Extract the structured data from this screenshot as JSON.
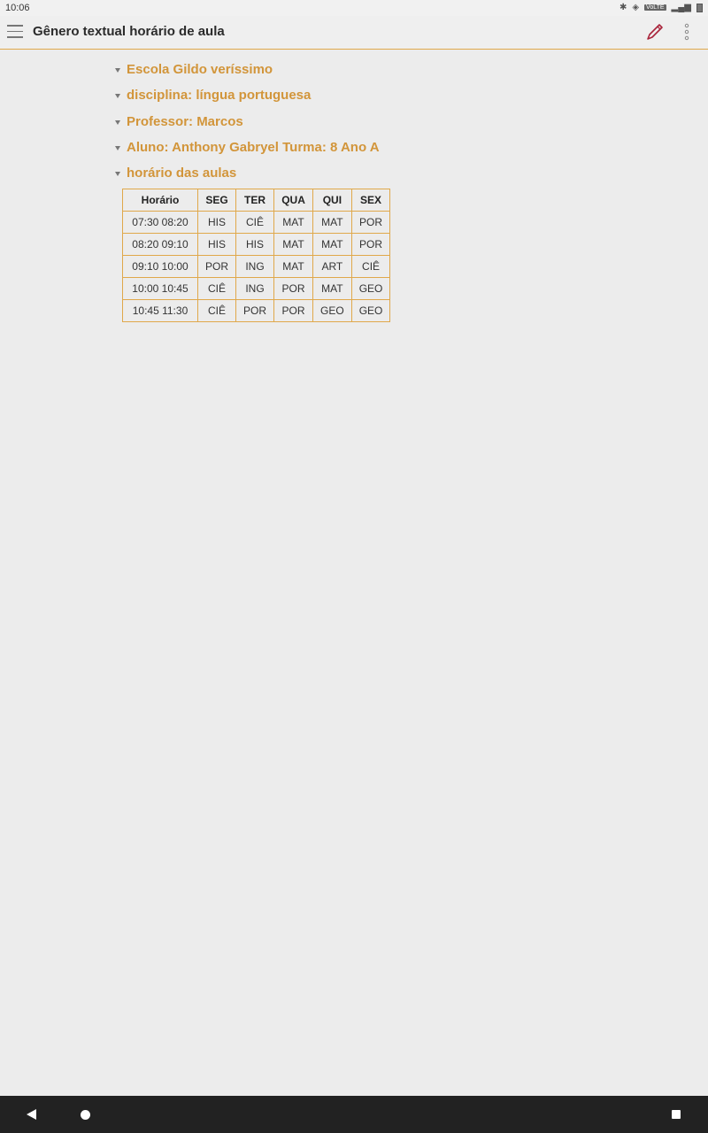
{
  "status_bar": {
    "time": "10:06",
    "icons": [
      "bluetooth-icon",
      "vibrate-icon",
      "volte-icon",
      "signal-icon",
      "battery-icon"
    ],
    "volte_label": "VoLTE"
  },
  "app_bar": {
    "title": "Gênero textual horário de aula",
    "icons": {
      "menu": "hamburger-menu-icon",
      "edit": "pencil-icon",
      "more": "more-vert-icon"
    },
    "accent_color": "#d2953a",
    "edit_icon_color": "#a9243b"
  },
  "outline": {
    "items": [
      {
        "text": "Escola Gildo veríssimo"
      },
      {
        "text": "disciplina: língua portuguesa"
      },
      {
        "text": "Professor: Marcos"
      },
      {
        "text": "Aluno: Anthony Gabryel Turma: 8 Ano A"
      },
      {
        "text": "horário das aulas"
      }
    ]
  },
  "schedule": {
    "headers": [
      "Horário",
      "SEG",
      "TER",
      "QUA",
      "QUI",
      "SEX"
    ],
    "rows": [
      [
        "07:30 08:20",
        "HIS",
        "CIÊ",
        "MAT",
        "MAT",
        "POR"
      ],
      [
        "08:20 09:10",
        "HIS",
        "HIS",
        "MAT",
        "MAT",
        "POR"
      ],
      [
        "09:10 10:00",
        "POR",
        "ING",
        "MAT",
        "ART",
        "CIÊ"
      ],
      [
        "10:00 10:45",
        "CIÊ",
        "ING",
        "POR",
        "MAT",
        "GEO"
      ],
      [
        "10:45 11:30",
        "CIÊ",
        "POR",
        "POR",
        "GEO",
        "GEO"
      ]
    ]
  },
  "nav_bar": {
    "icons": {
      "back": "back-triangle-icon",
      "home": "home-circle-icon",
      "recents": "recents-square-icon"
    }
  }
}
